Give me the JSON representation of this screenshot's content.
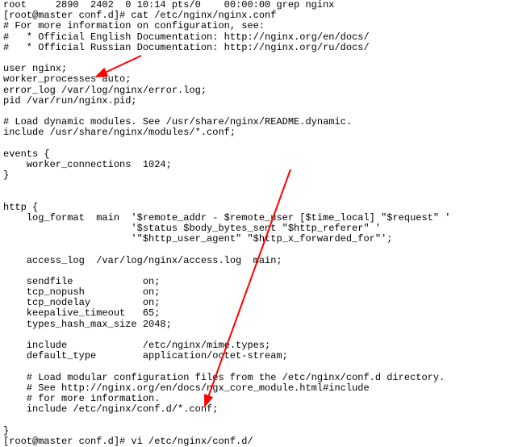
{
  "terminal": {
    "lines": [
      "root     2890  2402  0 10:14 pts/0    00:00:00 grep nginx",
      "[root@master conf.d]# cat /etc/nginx/nginx.conf",
      "# For more information on configuration, see:",
      "#   * Official English Documentation: http://nginx.org/en/docs/",
      "#   * Official Russian Documentation: http://nginx.org/ru/docs/",
      "",
      "user nginx;",
      "worker_processes auto;",
      "error_log /var/log/nginx/error.log;",
      "pid /var/run/nginx.pid;",
      "",
      "# Load dynamic modules. See /usr/share/nginx/README.dynamic.",
      "include /usr/share/nginx/modules/*.conf;",
      "",
      "events {",
      "    worker_connections  1024;",
      "}",
      "",
      "",
      "http {",
      "    log_format  main  '$remote_addr - $remote_user [$time_local] \"$request\" '",
      "                      '$status $body_bytes_sent \"$http_referer\" '",
      "                      '\"$http_user_agent\" \"$http_x_forwarded_for\"';",
      "",
      "    access_log  /var/log/nginx/access.log  main;",
      "",
      "    sendfile            on;",
      "    tcp_nopush          on;",
      "    tcp_nodelay         on;",
      "    keepalive_timeout   65;",
      "    types_hash_max_size 2048;",
      "",
      "    include             /etc/nginx/mime.types;",
      "    default_type        application/octet-stream;",
      "",
      "    # Load modular configuration files from the /etc/nginx/conf.d directory.",
      "    # See http://nginx.org/en/docs/ngx_core_module.html#include",
      "    # for more information.",
      "    include /etc/nginx/conf.d/*.conf;",
      "",
      "}",
      "[root@master conf.d]# vi /etc/nginx/conf.d/"
    ]
  },
  "annotations": {
    "arrow_color": "#ff0000"
  }
}
